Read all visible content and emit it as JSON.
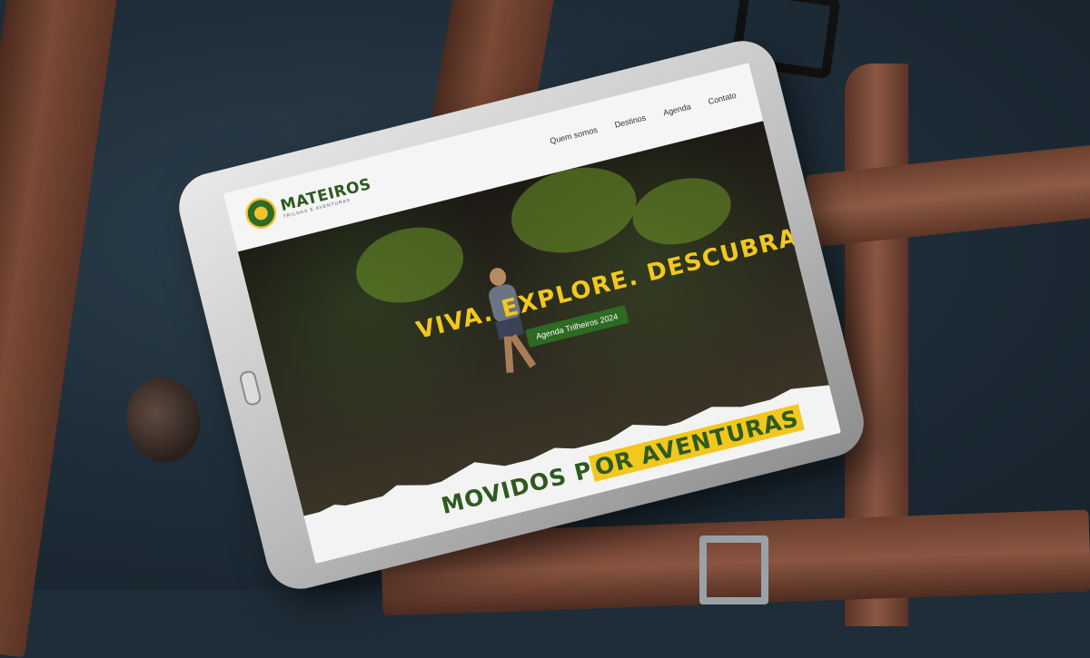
{
  "site": {
    "logo_name": "MATEIROS",
    "logo_tagline": "TRILHAS E AVENTURAS",
    "nav": [
      "Quem somos",
      "Destinos",
      "Agenda",
      "Contato"
    ]
  },
  "hero": {
    "title": "VIVA. EXPLORE. DESCUBRA",
    "cta_label": "Agenda Trilheiros 2024"
  },
  "section": {
    "title_part1": "MOVIDOS P",
    "title_part2": "OR AVENTURAS"
  },
  "colors": {
    "brand_green": "#2f5a1f",
    "accent_yellow": "#f2c81f"
  }
}
